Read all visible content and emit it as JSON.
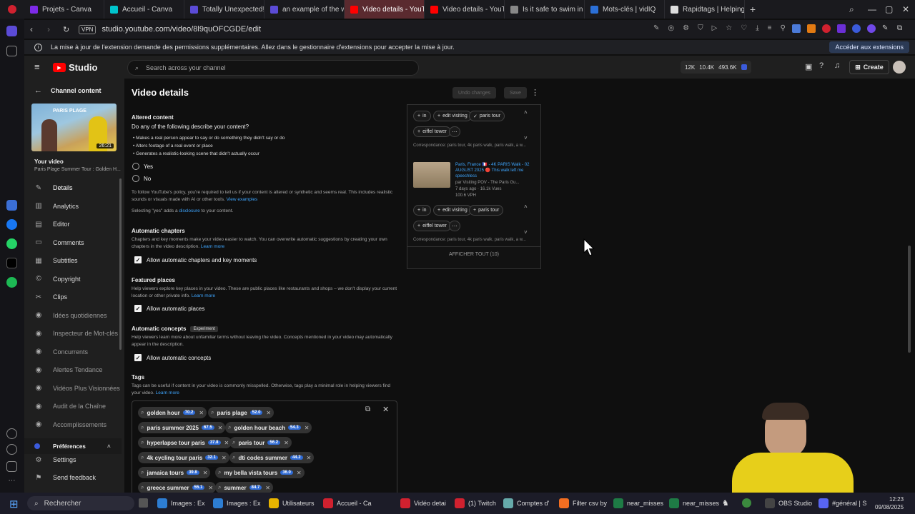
{
  "browser": {
    "tabs": [
      {
        "title": "Projets - Canva",
        "color": "#7d2ae8"
      },
      {
        "title": "Accueil - Canva",
        "color": "#00c4cc"
      },
      {
        "title": "Totally Unexpected! - Min",
        "color": "#5b4bd6"
      },
      {
        "title": "an example of the way co",
        "color": "#5b4bd6"
      },
      {
        "title": "Video details - YouTube S",
        "color": "#ff0000",
        "active": true
      },
      {
        "title": "Video details - YouTube S",
        "color": "#ff0000"
      },
      {
        "title": "Is it safe to swim in the Se",
        "color": "#888888"
      },
      {
        "title": "Mots-clés | vidIQ",
        "color": "#2b6fd6"
      },
      {
        "title": "Rapidtags | Helping you g",
        "color": "#dddddd"
      }
    ],
    "url": "studio.youtube.com/video/8l9quOFCGDE/edit",
    "vpn_label": "VPN",
    "infobar_text": "La mise à jour de l'extension demande des permissions supplémentaires. Allez dans le gestionnaire d'extensions pour accepter la mise à jour.",
    "infobar_button": "Accéder aux extensions"
  },
  "studio": {
    "logo_text": "Studio",
    "search_placeholder": "Search across your channel",
    "stats": [
      "12K",
      "10.4K",
      "493.6K"
    ],
    "create_label": "Create"
  },
  "sidebar": {
    "back_label": "Channel content",
    "thumb_title": "PARIS PLAGE",
    "thumb_duration": "26:21",
    "your_video_label": "Your video",
    "video_title": "Paris Plage Summer Tour : Golden H...",
    "items": [
      {
        "label": "Details",
        "icon": "✎",
        "active": true
      },
      {
        "label": "Analytics",
        "icon": "▥"
      },
      {
        "label": "Editor",
        "icon": "▤"
      },
      {
        "label": "Comments",
        "icon": "▭"
      },
      {
        "label": "Subtitles",
        "icon": "▦"
      },
      {
        "label": "Copyright",
        "icon": "©"
      },
      {
        "label": "Clips",
        "icon": "✂"
      },
      {
        "label": "Idées quotidiennes",
        "icon": "◉",
        "dim": true
      },
      {
        "label": "Inspecteur de Mot-clés",
        "icon": "◉",
        "dim": true
      },
      {
        "label": "Concurrents",
        "icon": "◉",
        "dim": true
      },
      {
        "label": "Alertes Tendance",
        "icon": "◉",
        "dim": true
      },
      {
        "label": "Vidéos Plus Visionnées",
        "icon": "◉",
        "dim": true
      },
      {
        "label": "Audit de la Chaîne",
        "icon": "◉",
        "dim": true
      },
      {
        "label": "Accomplissements",
        "icon": "◉",
        "dim": true
      }
    ],
    "preferences_label": "Préférences",
    "settings_label": "Settings",
    "feedback_label": "Send feedback"
  },
  "main": {
    "title": "Video details",
    "undo_label": "Undo changes",
    "save_label": "Save",
    "altered": {
      "heading": "Altered content",
      "question": "Do any of the following describe your content?",
      "bullets": [
        "Makes a real person appear to say or do something they didn't say or do",
        "Alters footage of a real event or place",
        "Generates a realistic-looking scene that didn't actually occur"
      ],
      "yes": "Yes",
      "no": "No",
      "policy_text": "To follow YouTube's policy, you're required to tell us if your content is altered or synthetic and seems real. This includes realistic sounds or visuals made with AI or other tools.",
      "policy_link": "View examples",
      "disclosure_text": "Selecting \"yes\" adds a",
      "disclosure_link": "disclosure",
      "disclosure_end": "to your content."
    },
    "chapters": {
      "heading": "Automatic chapters",
      "desc": "Chapters and key moments make your video easier to watch. You can overwrite automatic suggestions by creating your own chapters in the video description.",
      "learn": "Learn more",
      "checkbox": "Allow automatic chapters and key moments"
    },
    "places": {
      "heading": "Featured places",
      "desc": "Help viewers explore key places in your video. These are public places like restaurants and shops – we don't display your current location or other private info.",
      "learn": "Learn more",
      "checkbox": "Allow automatic places"
    },
    "concepts": {
      "heading": "Automatic concepts",
      "badge": "Experiment",
      "desc": "Help viewers learn more about unfamiliar terms without leaving the video. Concepts mentioned in your video may automatically appear in the description.",
      "checkbox": "Allow automatic concepts"
    },
    "tags": {
      "heading": "Tags",
      "desc": "Tags can be useful if content in your video is commonly misspelled. Otherwise, tags play a minimal role in helping viewers find your video.",
      "learn": "Learn more",
      "items": [
        {
          "label": "golden hour",
          "score": "70.2"
        },
        {
          "label": "paris plage",
          "score": "52.0"
        },
        {
          "label": "paris summer 2025",
          "score": "67.5"
        },
        {
          "label": "golden hour beach",
          "score": "54.3"
        },
        {
          "label": "hyperlapse tour paris",
          "score": "37.8"
        },
        {
          "label": "paris tour",
          "score": "56.2"
        },
        {
          "label": "4k cycling tour paris",
          "score": "32.1"
        },
        {
          "label": "dti codes summer",
          "score": "44.2"
        },
        {
          "label": "jamaica tours",
          "score": "39.8"
        },
        {
          "label": "my bella vista tours",
          "score": "36.0"
        },
        {
          "label": "greece summer",
          "score": "55.1"
        },
        {
          "label": "summer",
          "score": "84.7"
        }
      ]
    }
  },
  "panel": {
    "chips_row1": [
      "in",
      "edit visiting",
      "paris tour"
    ],
    "chip_eiffel": "eiffel tower",
    "match1": "Correspondance: paris tour, 4k paris walk, paris walk, a w...",
    "video_title": "Paris, France 🇫🇷 - 4K PARIS Walk - 02 AUGUST 2025 🔴 This walk left me speechless",
    "video_channel": "par Visiting POV - The Paris Gu...",
    "video_meta": "7 days ago · 16.1k Vues",
    "video_vph": "100.6 VPH",
    "match2": "Correspondance: paris tour, 4k paris walk, paris walk, a w...",
    "show_all": "AFFICHER TOUT (10)"
  },
  "taskbar": {
    "search": "Rechercher",
    "items": [
      {
        "label": "Images : Ex",
        "color": "#2d7dd2"
      },
      {
        "label": "Images : Ex",
        "color": "#2d7dd2"
      },
      {
        "label": "Utilisateurs",
        "color": "#e8b400"
      },
      {
        "label": "Accueil - Ca",
        "color": "#d0212f"
      },
      {
        "label": "Vidéo detai",
        "color": "#d0212f"
      },
      {
        "label": "(1) Twitch",
        "color": "#d0212f"
      },
      {
        "label": "Comptes d'",
        "color": "#6aa"
      },
      {
        "label": "Filter csv by",
        "color": "#f36e21"
      },
      {
        "label": "near_misses",
        "color": "#1e7b45"
      },
      {
        "label": "near_misses",
        "color": "#1e7b45"
      },
      {
        "label": "OBS Studio",
        "color": "#444"
      },
      {
        "label": "#général | S",
        "color": "#5865f2"
      }
    ],
    "time": "12:23",
    "date": "09/08/2025"
  }
}
